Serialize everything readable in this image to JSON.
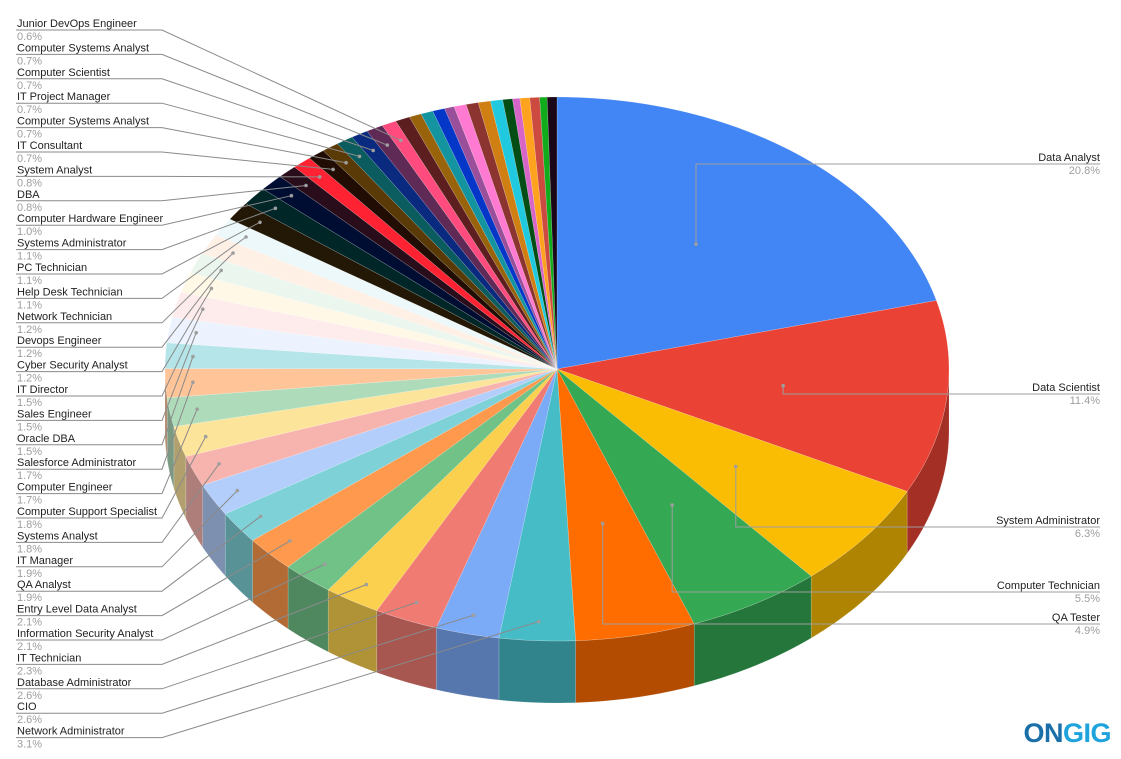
{
  "chart_data": {
    "type": "pie",
    "style": "3d",
    "title": "",
    "start_angle": "12 o'clock, clockwise",
    "unit": "%",
    "slices": [
      {
        "label": "Data Analyst",
        "value": 20.8,
        "color": "#4285f4",
        "label_side": "right"
      },
      {
        "label": "Data Scientist",
        "value": 11.4,
        "color": "#ea4335",
        "label_side": "right"
      },
      {
        "label": "System Administrator",
        "value": 6.3,
        "color": "#fbbc04",
        "label_side": "right"
      },
      {
        "label": "Computer Technician",
        "value": 5.5,
        "color": "#34a853",
        "label_side": "right"
      },
      {
        "label": "QA Tester",
        "value": 4.9,
        "color": "#ff6d01",
        "label_side": "right"
      },
      {
        "label": "Network Administrator",
        "value": 3.1,
        "color": "#46bdc6",
        "label_side": "left"
      },
      {
        "label": "CIO",
        "value": 2.6,
        "color": "#7baaf7",
        "label_side": "left"
      },
      {
        "label": "Database Administrator",
        "value": 2.6,
        "color": "#f07b72",
        "label_side": "left"
      },
      {
        "label": "IT Technician",
        "value": 2.3,
        "color": "#fcd04f",
        "label_side": "left"
      },
      {
        "label": "Information Security Analyst",
        "value": 2.1,
        "color": "#71c287",
        "label_side": "left"
      },
      {
        "label": "Entry Level Data Analyst",
        "value": 2.1,
        "color": "#ff994d",
        "label_side": "left"
      },
      {
        "label": "QA Analyst",
        "value": 1.9,
        "color": "#7ed1d7",
        "label_side": "left"
      },
      {
        "label": "IT Manager",
        "value": 1.9,
        "color": "#b3cefb",
        "label_side": "left"
      },
      {
        "label": "Systems Analyst",
        "value": 1.8,
        "color": "#f7b4ae",
        "label_side": "left"
      },
      {
        "label": "Computer Support Specialist",
        "value": 1.8,
        "color": "#fde49b",
        "label_side": "left"
      },
      {
        "label": "Computer Engineer",
        "value": 1.7,
        "color": "#aedcba",
        "label_side": "left"
      },
      {
        "label": "Salesforce Administrator",
        "value": 1.7,
        "color": "#ffc599",
        "label_side": "left"
      },
      {
        "label": "Oracle DBA",
        "value": 1.5,
        "color": "#b5e5e8",
        "label_side": "left"
      },
      {
        "label": "Sales Engineer",
        "value": 1.5,
        "color": "#ecf2fe",
        "label_side": "left"
      },
      {
        "label": "IT Director",
        "value": 1.5,
        "color": "#fdeceb",
        "label_side": "left"
      },
      {
        "label": "Cyber Security Analyst",
        "value": 1.2,
        "color": "#fff8e6",
        "label_side": "left"
      },
      {
        "label": "Devops Engineer",
        "value": 1.2,
        "color": "#ebf6ee",
        "label_side": "left"
      },
      {
        "label": "Network Technician",
        "value": 1.2,
        "color": "#fff0e6",
        "label_side": "left"
      },
      {
        "label": "Help Desk Technician",
        "value": 1.1,
        "color": "#ecf8f9",
        "label_side": "left"
      },
      {
        "label": "PC Technician",
        "value": 1.1,
        "color": "#231705",
        "label_side": "left"
      },
      {
        "label": "Systems Administrator",
        "value": 1.1,
        "color": "#012628",
        "label_side": "left"
      },
      {
        "label": "Computer Hardware Engineer",
        "value": 1.0,
        "color": "#000d33",
        "label_side": "left"
      },
      {
        "label": "DBA",
        "value": 0.8,
        "color": "#2a0d1b",
        "label_side": "left"
      },
      {
        "label": "System Analyst",
        "value": 0.8,
        "color": "#ff2233",
        "label_side": "left"
      },
      {
        "label": "IT Consultant",
        "value": 0.7,
        "color": "#220d05",
        "label_side": "left"
      },
      {
        "label": "Computer Systems Analyst",
        "value": 0.7,
        "color": "#5a3a06",
        "label_side": "left"
      },
      {
        "label": "IT Project Manager",
        "value": 0.7,
        "color": "#0b5c5e",
        "label_side": "left"
      },
      {
        "label": "Computer Scientist",
        "value": 0.7,
        "color": "#0a2a80",
        "label_side": "left"
      },
      {
        "label": "Computer Systems Analyst",
        "value": 0.7,
        "color": "#5f2a56",
        "label_side": "left"
      },
      {
        "label": "Junior DevOps Engineer",
        "value": 0.6,
        "color": "#ff4b7d",
        "label_side": "left"
      },
      {
        "label": "",
        "value": 0.6,
        "color": "#5c1e1e"
      },
      {
        "label": "",
        "value": 0.5,
        "color": "#99630c"
      },
      {
        "label": "",
        "value": 0.5,
        "color": "#13949e"
      },
      {
        "label": "",
        "value": 0.5,
        "color": "#0437c8"
      },
      {
        "label": "",
        "value": 0.4,
        "color": "#9a4f9a"
      },
      {
        "label": "",
        "value": 0.5,
        "color": "#ff7ad0"
      },
      {
        "label": "",
        "value": 0.5,
        "color": "#8b3430"
      },
      {
        "label": "",
        "value": 0.5,
        "color": "#d07f13"
      },
      {
        "label": "",
        "value": 0.5,
        "color": "#20c9dd"
      },
      {
        "label": "",
        "value": 0.4,
        "color": "#044e15"
      },
      {
        "label": "",
        "value": 0.3,
        "color": "#d765c8"
      },
      {
        "label": "",
        "value": 0.4,
        "color": "#ffa31e"
      },
      {
        "label": "",
        "value": 0.4,
        "color": "#cc4a40"
      },
      {
        "label": "",
        "value": 0.3,
        "color": "#10ac1b"
      },
      {
        "label": "",
        "value": 0.4,
        "color": "#1a0818"
      }
    ]
  },
  "logo": {
    "part1": "ON",
    "part2": "GIG"
  }
}
